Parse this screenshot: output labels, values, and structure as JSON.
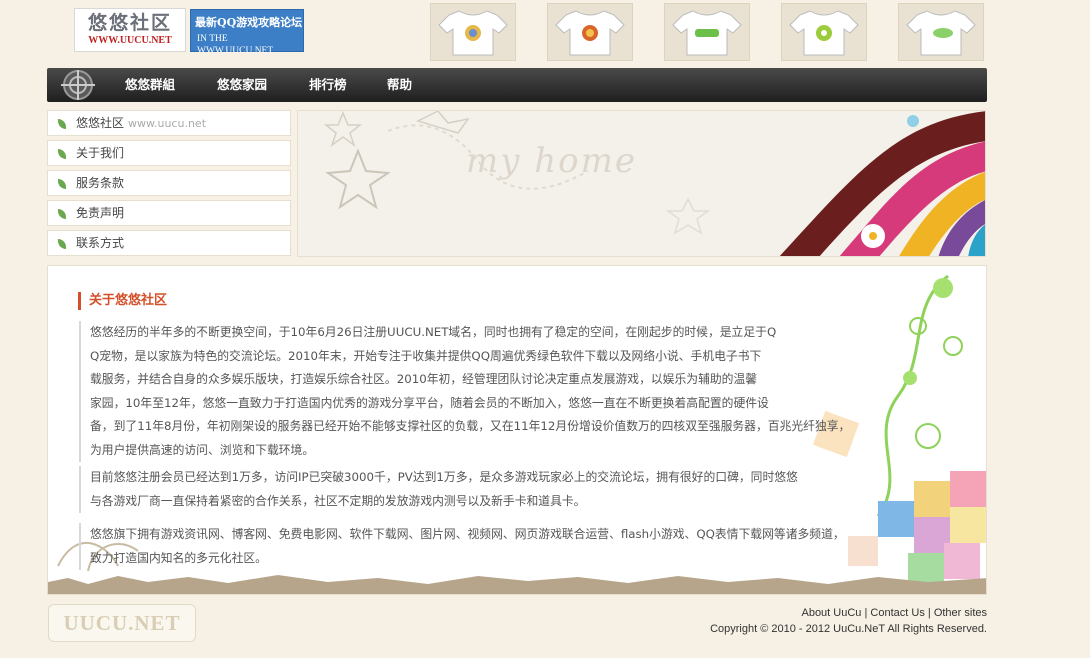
{
  "header": {
    "logo_cn": "悠悠社区",
    "logo_url": "WWW.UUCU.NET",
    "slogan_cn": "最新QQ游戏攻略论坛",
    "slogan_en": "IN THE WWW.UUCU.NET",
    "tshirt_icons": [
      "tshirt-icon",
      "tshirt-icon",
      "tshirt-icon",
      "tshirt-icon",
      "tshirt-icon"
    ]
  },
  "nav": {
    "home_icon": "compass-icon",
    "items": [
      "悠悠群組",
      "悠悠家园",
      "排行榜",
      "帮助"
    ]
  },
  "sidebar": {
    "items": [
      {
        "label": "悠悠社区",
        "sub": "www.uucu.net"
      },
      {
        "label": "关于我们",
        "sub": ""
      },
      {
        "label": "服务条款",
        "sub": ""
      },
      {
        "label": "免责声明",
        "sub": ""
      },
      {
        "label": "联系方式",
        "sub": ""
      }
    ]
  },
  "banner": {
    "text": "my home"
  },
  "content": {
    "title": "关于悠悠社区",
    "p1": [
      "悠悠经历的半年多的不断更换空间，于10年6月26日注册UUCU.NET域名，同时也拥有了稳定的空间，在刚起步的时候，是立足于Q",
      "Q宠物，是以家族为特色的交流论坛。2010年末，开始专注于收集并提供QQ周遍优秀绿色软件下载以及网络小说、手机电子书下",
      "载服务，并结合自身的众多娱乐版块，打造娱乐综合社区。2010年初，经管理团队讨论决定重点发展游戏，以娱乐为辅助的温馨",
      "家园，10年至12年，悠悠一直致力于打造国内优秀的游戏分享平台，随着会员的不断加入，悠悠一直在不断更换着高配置的硬件设",
      "备，到了11年8月份，年初刚架设的服务器已经开始不能够支撑社区的负载，又在11年12月份增设价值数万的四核双至强服务器，百兆光纤独享，",
      "为用户提供高速的访问、浏览和下载环境。"
    ],
    "p2": [
      "目前悠悠注册会员已经达到1万多，访问IP已突破3000千，PV达到1万多，是众多游戏玩家必上的交流论坛，拥有很好的口碑，同时悠悠",
      "与各游戏厂商一直保持着紧密的合作关系，社区不定期的发放游戏内测号以及新手卡和道具卡。"
    ],
    "p3": [
      "悠悠旗下拥有游戏资讯网、博客网、免费电影网、软件下载网、图片网、视频网、网页游戏联合运营、flash小游戏、QQ表情下载网等诸多频道，",
      "致力打造国内知名的多元化社区。"
    ]
  },
  "footer": {
    "logo": "UUCU.NET",
    "links": [
      "About UuCu",
      "Contact Us",
      "Other sites"
    ],
    "separator": "|",
    "copyright": "Copyright © 2010 - 2012 UuCu.NeT All Rights Reserved."
  }
}
